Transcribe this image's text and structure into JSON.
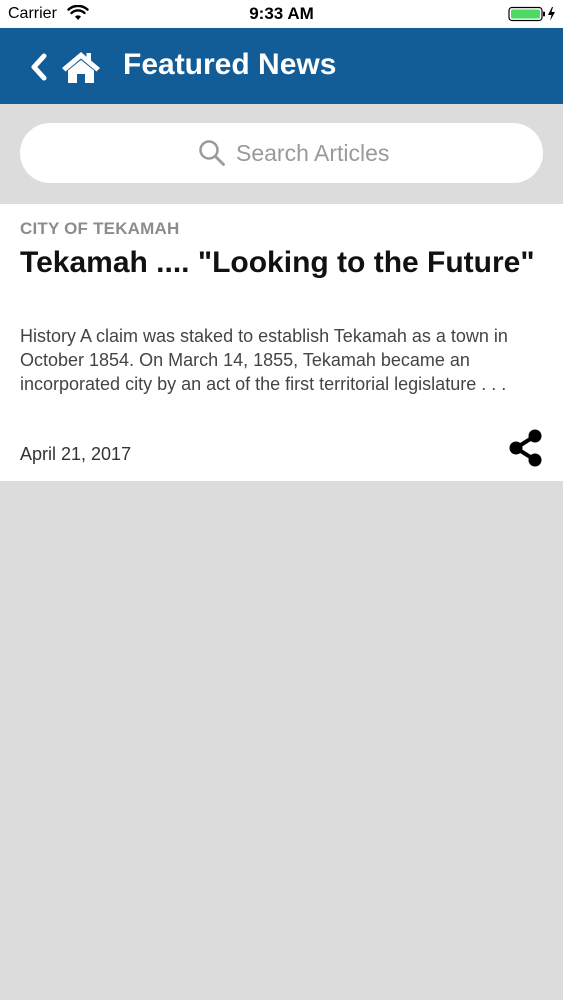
{
  "status_bar": {
    "carrier": "Carrier",
    "time": "9:33 AM",
    "wifi_icon": "wifi-icon",
    "battery_icon": "battery-charging-icon",
    "battery_color": "#4cd964"
  },
  "header": {
    "title": "Featured News",
    "background_color": "#125d98",
    "back_icon": "chevron-left-icon",
    "home_icon": "home-icon"
  },
  "search": {
    "placeholder": "Search Articles",
    "value": "",
    "icon": "search-icon"
  },
  "articles": [
    {
      "source": "CITY OF TEKAMAH",
      "title": "Tekamah .... \"Looking to the Future\"",
      "summary": "History A claim was staked to establish Tekamah as a town in October 1854. On March 14, 1855, Tekamah became an incorporated city by an act of the first territorial legislature . . .",
      "date": "April 21, 2017",
      "share_icon": "share-icon"
    }
  ]
}
